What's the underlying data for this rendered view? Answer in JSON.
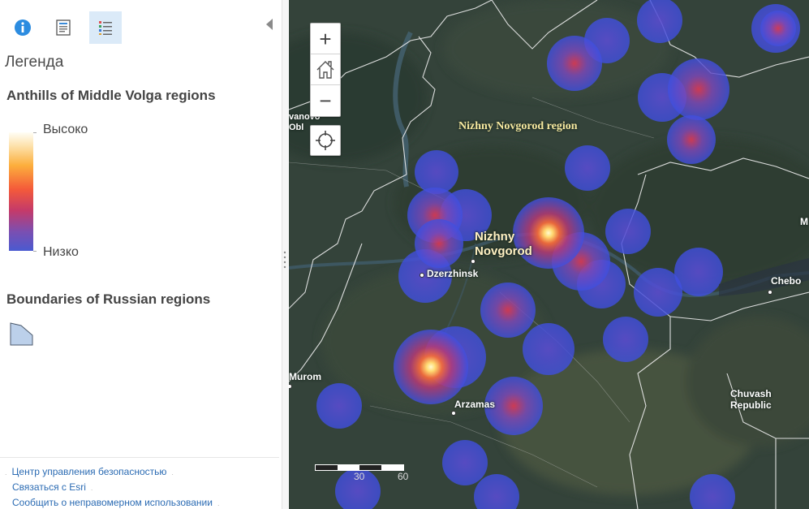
{
  "toolbar": {
    "info_icon": "info-icon",
    "details_icon": "document-icon",
    "legend_icon": "legend-list-icon",
    "collapse_icon": "collapse-left-icon"
  },
  "legend": {
    "heading": "Легенда",
    "layers": [
      {
        "title": "Anthills of Middle Volga regions",
        "ramp_high": "Высоко",
        "ramp_low": "Низко"
      },
      {
        "title": "Boundaries of Russian regions"
      }
    ]
  },
  "footer": {
    "links": [
      "Центр управления безопасностью",
      "Связаться с Esri",
      "Сообщить о неправомерном использовании"
    ]
  },
  "map": {
    "region_label": "Nizhny Novgorod region",
    "cities": {
      "nizhny_line1": "Nizhny",
      "nizhny_line2": "Novgorod",
      "dzerzhinsk": "Dzerzhinsk",
      "arzamas": "Arzamas",
      "murom": "Murom",
      "cheboksary": "Chebo",
      "chuvash_line1": "Chuvash",
      "chuvash_line2": "Republic",
      "ivanovo_line1": "vanovo",
      "ivanovo_line2": "Obl",
      "edge_m": "M"
    },
    "scale": {
      "left": "30",
      "right": "60"
    },
    "controls": {
      "zoom_in": "+",
      "zoom_out": "−"
    },
    "colors": {
      "heat_low": "#3f4fe0",
      "heat_mid": "#d2364f",
      "heat_high": "#fff6a8",
      "boundary": "#eeeeee"
    }
  }
}
